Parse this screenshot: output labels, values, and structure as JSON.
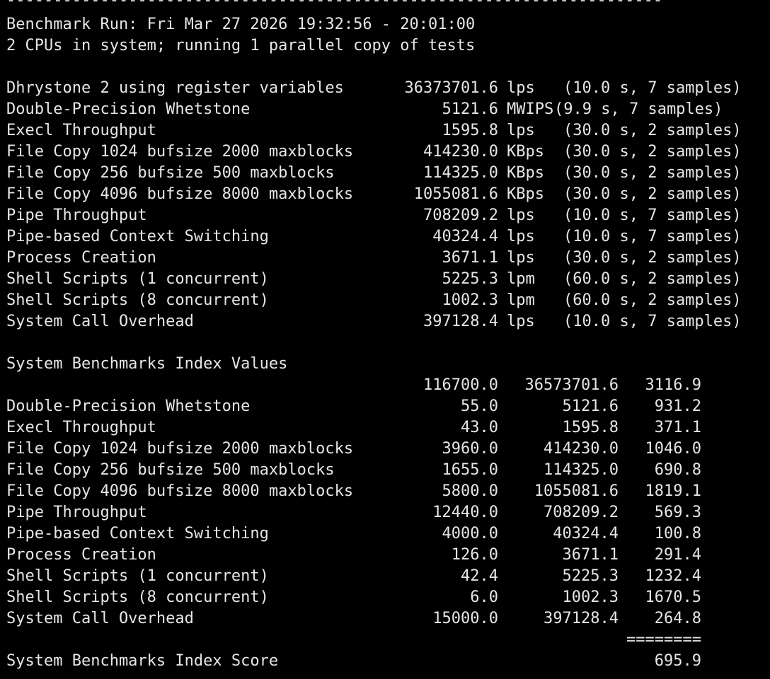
{
  "terminal": {
    "dashes": "----------------------------------------------------------------------",
    "run_line": "Benchmark Run: Fri Mar 27 2026 19:32:56 - 20:01:00",
    "cpu_line": "2 CPUs in system; running 1 parallel copy of tests",
    "results": [
      {
        "name": "Dhrystone 2 using register variables",
        "value": "36373701.6",
        "unit": "lps",
        "meta": "(10.0 s, 7 samples)"
      },
      {
        "name": "Double-Precision Whetstone",
        "value": "5121.6",
        "unit": "MWIPS",
        "meta": "(9.9 s, 7 samples)"
      },
      {
        "name": "Execl Throughput",
        "value": "1595.8",
        "unit": "lps",
        "meta": "(30.0 s, 2 samples)"
      },
      {
        "name": "File Copy 1024 bufsize 2000 maxblocks",
        "value": "414230.0",
        "unit": "KBps",
        "meta": "(30.0 s, 2 samples)"
      },
      {
        "name": "File Copy 256 bufsize 500 maxblocks",
        "value": "114325.0",
        "unit": "KBps",
        "meta": "(30.0 s, 2 samples)"
      },
      {
        "name": "File Copy 4096 bufsize 8000 maxblocks",
        "value": "1055081.6",
        "unit": "KBps",
        "meta": "(30.0 s, 2 samples)"
      },
      {
        "name": "Pipe Throughput",
        "value": "708209.2",
        "unit": "lps",
        "meta": "(10.0 s, 7 samples)"
      },
      {
        "name": "Pipe-based Context Switching",
        "value": "40324.4",
        "unit": "lps",
        "meta": "(10.0 s, 7 samples)"
      },
      {
        "name": "Process Creation",
        "value": "3671.1",
        "unit": "lps",
        "meta": "(30.0 s, 2 samples)"
      },
      {
        "name": "Shell Scripts (1 concurrent)",
        "value": "5225.3",
        "unit": "lpm",
        "meta": "(60.0 s, 2 samples)"
      },
      {
        "name": "Shell Scripts (8 concurrent)",
        "value": "1002.3",
        "unit": "lpm",
        "meta": "(60.0 s, 2 samples)"
      },
      {
        "name": "System Call Overhead",
        "value": "397128.4",
        "unit": "lps",
        "meta": "(10.0 s, 7 samples)"
      }
    ],
    "index_heading": "System Benchmarks Index Values",
    "index_rows": [
      {
        "name": "",
        "baseline": "116700.0",
        "result": "36573701.6",
        "index": "3116.9"
      },
      {
        "name": "Double-Precision Whetstone",
        "baseline": "55.0",
        "result": "5121.6",
        "index": "931.2"
      },
      {
        "name": "Execl Throughput",
        "baseline": "43.0",
        "result": "1595.8",
        "index": "371.1"
      },
      {
        "name": "File Copy 1024 bufsize 2000 maxblocks",
        "baseline": "3960.0",
        "result": "414230.0",
        "index": "1046.0"
      },
      {
        "name": "File Copy 256 bufsize 500 maxblocks",
        "baseline": "1655.0",
        "result": "114325.0",
        "index": "690.8"
      },
      {
        "name": "File Copy 4096 bufsize 8000 maxblocks",
        "baseline": "5800.0",
        "result": "1055081.6",
        "index": "1819.1"
      },
      {
        "name": "Pipe Throughput",
        "baseline": "12440.0",
        "result": "708209.2",
        "index": "569.3"
      },
      {
        "name": "Pipe-based Context Switching",
        "baseline": "4000.0",
        "result": "40324.4",
        "index": "100.8"
      },
      {
        "name": "Process Creation",
        "baseline": "126.0",
        "result": "3671.1",
        "index": "291.4"
      },
      {
        "name": "Shell Scripts (1 concurrent)",
        "baseline": "42.4",
        "result": "5225.3",
        "index": "1232.4"
      },
      {
        "name": "Shell Scripts (8 concurrent)",
        "baseline": "6.0",
        "result": "1002.3",
        "index": "1670.5"
      },
      {
        "name": "System Call Overhead",
        "baseline": "15000.0",
        "result": "397128.4",
        "index": "264.8"
      }
    ],
    "equals_rule": "========",
    "score_label": "System Benchmarks Index Score",
    "score_value": "695.9"
  }
}
